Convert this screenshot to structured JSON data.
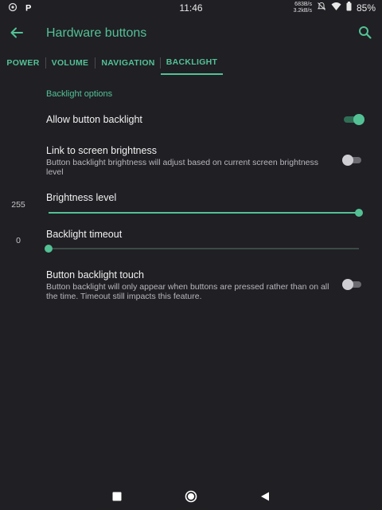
{
  "status_bar": {
    "time": "11:46",
    "net_down": "683B/s",
    "net_up": "3.2kB/s",
    "battery": "85%",
    "left_icons": [
      "location-icon",
      "parking-app-icon"
    ],
    "right_icons": [
      "notifications-off-icon",
      "wifi-icon",
      "battery-icon"
    ]
  },
  "toolbar": {
    "title": "Hardware buttons",
    "back_icon": "arrow-back-icon",
    "search_icon": "search-icon"
  },
  "tabs": [
    {
      "label": "POWER",
      "active": false
    },
    {
      "label": "VOLUME",
      "active": false
    },
    {
      "label": "NAVIGATION",
      "active": false
    },
    {
      "label": "BACKLIGHT",
      "active": true
    }
  ],
  "backlight": {
    "section_title": "Backlight options",
    "allow_backlight": {
      "title": "Allow button backlight",
      "enabled": true
    },
    "link_brightness": {
      "title": "Link to screen brightness",
      "summary": "Button backlight brightness will adjust based on current screen brightness level",
      "enabled": false
    },
    "brightness_level": {
      "title": "Brightness level",
      "value": "255",
      "fraction": 1.0
    },
    "backlight_timeout": {
      "title": "Backlight timeout",
      "value": "0",
      "fraction": 0.0
    },
    "backlight_touch": {
      "title": "Button backlight touch",
      "summary": "Button backlight will only appear when buttons are pressed rather than on all the time. Timeout still impacts this feature.",
      "enabled": false
    }
  },
  "nav_bar": {
    "buttons": [
      "recents-icon",
      "home-icon",
      "back-icon"
    ]
  },
  "colors": {
    "accent": "#53c194",
    "background": "#1f1f24"
  }
}
